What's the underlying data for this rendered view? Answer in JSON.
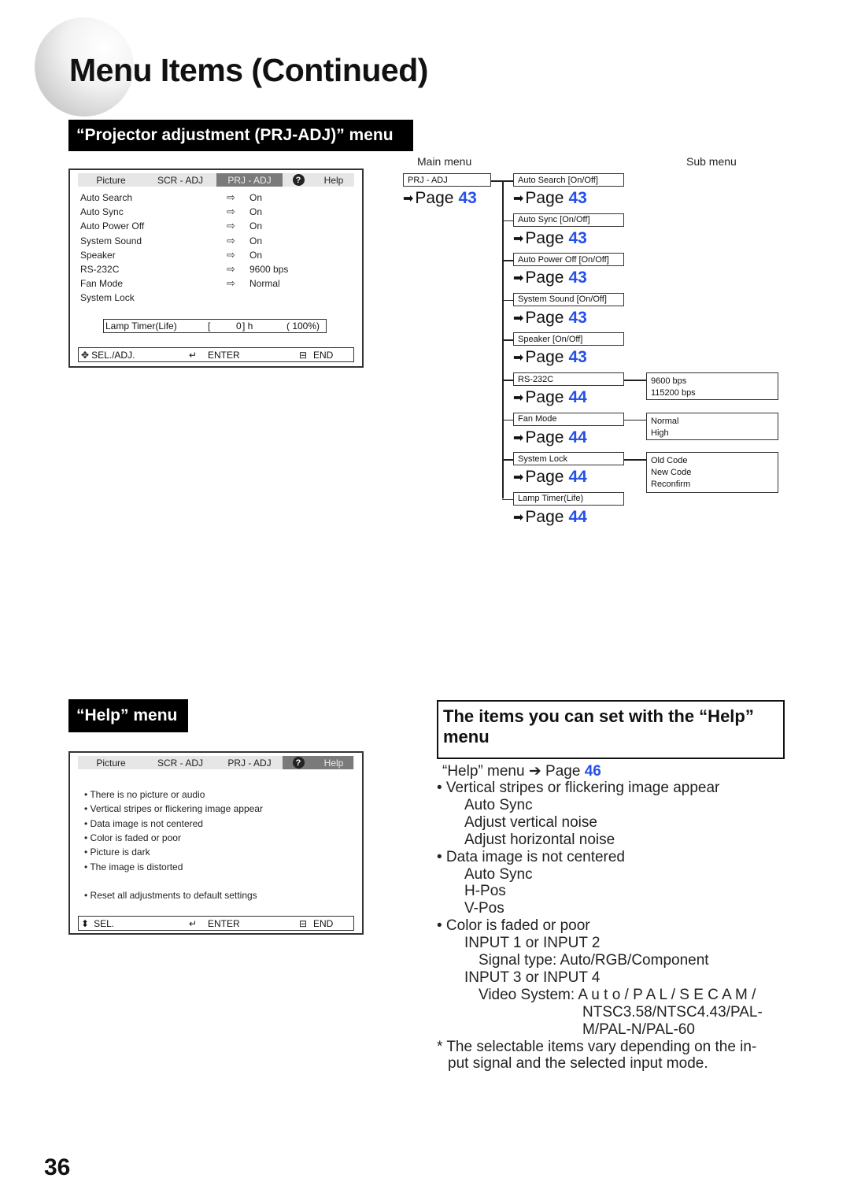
{
  "page_title": "Menu Items (Continued)",
  "page_number": "36",
  "prj_section": {
    "heading": "“Projector adjustment (PRJ-ADJ)” menu",
    "osd": {
      "tabs": [
        "Picture",
        "SCR - ADJ",
        "PRJ - ADJ",
        "Help"
      ],
      "active_tab": "PRJ - ADJ",
      "items": [
        {
          "label": "Auto Search",
          "value": "On"
        },
        {
          "label": "Auto Sync",
          "value": "On"
        },
        {
          "label": "Auto Power Off",
          "value": "On"
        },
        {
          "label": "System Sound",
          "value": "On"
        },
        {
          "label": "Speaker",
          "value": "On"
        },
        {
          "label": "RS-232C",
          "value": "9600 bps"
        },
        {
          "label": "Fan Mode",
          "value": "Normal"
        },
        {
          "label": "System Lock",
          "value": ""
        }
      ],
      "lamp": {
        "label": "Lamp Timer(Life)",
        "open": "[",
        "hours": "0",
        "close": "] h",
        "percent": "( 100%)"
      },
      "footer": {
        "sel": "SEL./ADJ.",
        "enter": "ENTER",
        "end": "END"
      }
    },
    "tree": {
      "main_label": "Main menu",
      "sub_label": "Sub menu",
      "main_item": {
        "label": "PRJ - ADJ",
        "page_word": "Page",
        "page": "43"
      },
      "items": [
        {
          "label": "Auto Search [On/Off]",
          "page_word": "Page",
          "page": "43",
          "options": []
        },
        {
          "label": "Auto Sync [On/Off]",
          "page_word": "Page",
          "page": "43",
          "options": []
        },
        {
          "label": "Auto Power Off [On/Off]",
          "page_word": "Page",
          "page": "43",
          "options": []
        },
        {
          "label": "System Sound [On/Off]",
          "page_word": "Page",
          "page": "43",
          "options": []
        },
        {
          "label": "Speaker [On/Off]",
          "page_word": "Page",
          "page": "43",
          "options": []
        },
        {
          "label": "RS-232C",
          "page_word": "Page",
          "page": "44",
          "options": [
            "9600 bps",
            "115200 bps"
          ]
        },
        {
          "label": "Fan Mode",
          "page_word": "Page",
          "page": "44",
          "options": [
            "Normal",
            "High"
          ]
        },
        {
          "label": "System Lock",
          "page_word": "Page",
          "page": "44",
          "options": [
            "Old Code",
            "New Code",
            "Reconfirm"
          ]
        },
        {
          "label": "Lamp Timer(Life)",
          "page_word": "Page",
          "page": "44",
          "options": []
        }
      ]
    }
  },
  "help_section": {
    "heading": "“Help” menu",
    "osd": {
      "tabs": [
        "Picture",
        "SCR - ADJ",
        "PRJ - ADJ",
        "Help"
      ],
      "active_tab": "Help",
      "items": [
        "There is no picture or audio",
        "Vertical stripes or flickering image appear",
        "Data image is not centered",
        "Color is faded or poor",
        "Picture is dark",
        "The image is distorted"
      ],
      "reset_item": "Reset all adjustments to default settings",
      "footer": {
        "sel": "SEL.",
        "enter": "ENTER",
        "end": "END"
      }
    }
  },
  "help_items": {
    "heading": "The items you can set with the “Help” menu",
    "ref": {
      "text": "“Help” menu",
      "arrow": "➔",
      "page_word": "Page",
      "page": "46"
    },
    "lines": [
      {
        "text": "• Vertical stripes or flickering image appear",
        "level": 0
      },
      {
        "text": "Auto Sync",
        "level": 1
      },
      {
        "text": "Adjust vertical noise",
        "level": 1
      },
      {
        "text": "Adjust horizontal noise",
        "level": 1
      },
      {
        "text": "• Data image is not centered",
        "level": 0
      },
      {
        "text": "Auto Sync",
        "level": 1
      },
      {
        "text": "H-Pos",
        "level": 1
      },
      {
        "text": "V-Pos",
        "level": 1
      },
      {
        "text": "• Color is faded or poor",
        "level": 0
      },
      {
        "text": "INPUT 1 or INPUT 2",
        "level": 1
      },
      {
        "text": "Signal type: Auto/RGB/Component",
        "level": 2
      },
      {
        "text": "INPUT 3 or INPUT 4",
        "level": 1
      },
      {
        "text": "Video System: A u t o / P A L / S E C A M /",
        "level": 2
      },
      {
        "text": "NTSC3.58/NTSC4.43/PAL-",
        "level": 3
      },
      {
        "text": "M/PAL-N/PAL-60",
        "level": 3
      },
      {
        "text": "* The selectable items vary depending on the in-",
        "level": 0
      },
      {
        "text": "put signal and the selected input mode.",
        "level": 4
      }
    ]
  }
}
